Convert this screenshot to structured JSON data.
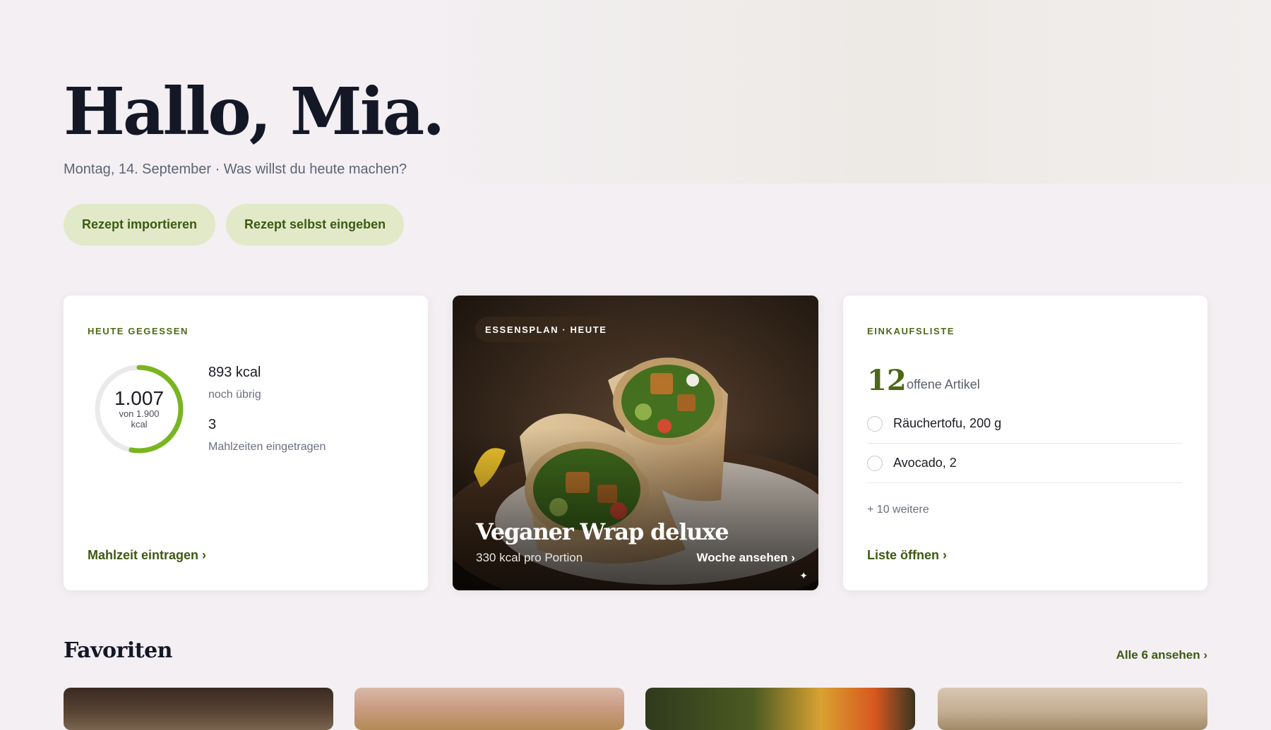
{
  "header": {
    "greeting": "Hallo, Mia.",
    "subline": "Montag, 14. September · Was willst du heute machen?"
  },
  "actions": {
    "import_label": "Rezept importieren",
    "manual_label": "Rezept selbst eingeben"
  },
  "eaten_card": {
    "eyebrow": "HEUTE GEGESSEN",
    "consumed": "1.007",
    "goal_line1": "von 1.900",
    "goal_line2": "kcal",
    "progress": 0.53,
    "remaining_value": "893 kcal",
    "remaining_label": "noch übrig",
    "meals_value": "3",
    "meals_label": "Mahlzeiten eingetragen",
    "link": "Mahlzeit eintragen ›"
  },
  "plan_card": {
    "tag": "ESSENSPLAN · HEUTE",
    "title": "Veganer Wrap deluxe",
    "kcal": "330 kcal pro Portion",
    "link": "Woche ansehen ›",
    "sparkle": "✦"
  },
  "shopping_card": {
    "eyebrow": "EINKAUFSLISTE",
    "count": "12",
    "count_label": "offene Artikel",
    "items": [
      {
        "label": "Räuchertofu, 200 g"
      },
      {
        "label": "Avocado, 2"
      }
    ],
    "more": "+ 10 weitere",
    "link": "Liste öffnen ›"
  },
  "favorites": {
    "title": "Favoriten",
    "all_link": "Alle 6 ansehen ›"
  },
  "colors": {
    "accent": "#3d5a12",
    "accent_soft": "#e1e9c8",
    "ring": "#79b51f",
    "background": "#f3eff2"
  }
}
